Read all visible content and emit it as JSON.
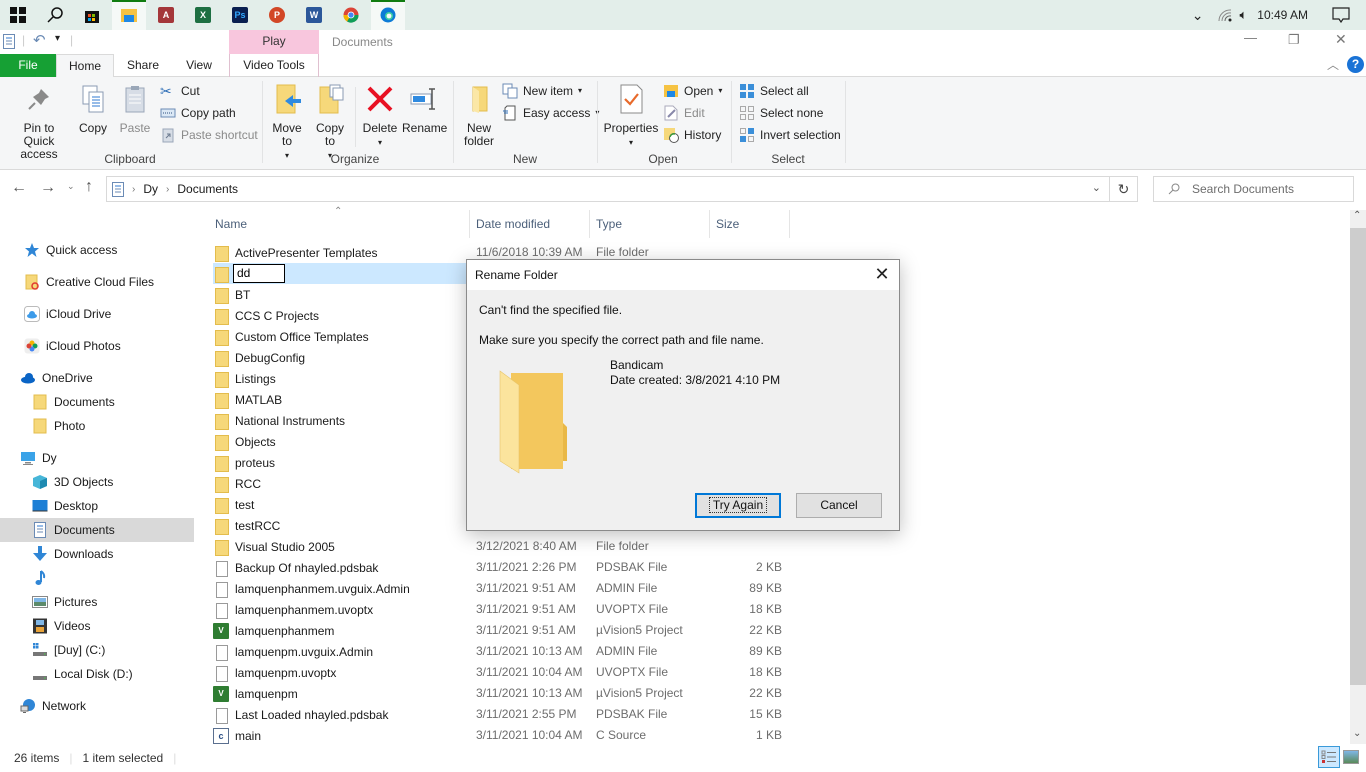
{
  "taskbar": {
    "apps": [
      {
        "name": "start",
        "label": "Start"
      },
      {
        "name": "search",
        "label": "Search"
      },
      {
        "name": "store",
        "label": "Microsoft Store"
      },
      {
        "name": "file-explorer",
        "label": "File Explorer",
        "active": true
      },
      {
        "name": "access",
        "label": "A"
      },
      {
        "name": "excel",
        "label": "X"
      },
      {
        "name": "photoshop",
        "label": "Ps"
      },
      {
        "name": "powerpoint",
        "label": "P"
      },
      {
        "name": "word",
        "label": "W"
      },
      {
        "name": "chrome",
        "label": "Chrome"
      },
      {
        "name": "edge",
        "label": "Edge",
        "active": true
      }
    ],
    "clock": "10:49 AM"
  },
  "window": {
    "title": "Documents",
    "contextual_tab_group": "Play",
    "minimize": "—",
    "restore": "❐",
    "close": "✕",
    "help": "?"
  },
  "tabs": {
    "file": "File",
    "home": "Home",
    "share": "Share",
    "view": "View",
    "video_tools": "Video Tools"
  },
  "ribbon": {
    "clipboard": {
      "label": "Clipboard",
      "pin": "Pin to Quick access",
      "copy": "Copy",
      "paste": "Paste",
      "cut": "Cut",
      "copy_path": "Copy path",
      "paste_shortcut": "Paste shortcut"
    },
    "organize": {
      "label": "Organize",
      "move_to": "Move to",
      "copy_to": "Copy to",
      "delete": "Delete",
      "rename": "Rename"
    },
    "new": {
      "label": "New",
      "new_folder": "New folder",
      "new_item": "New item",
      "easy_access": "Easy access"
    },
    "open": {
      "label": "Open",
      "properties": "Properties",
      "open": "Open",
      "edit": "Edit",
      "history": "History"
    },
    "select": {
      "label": "Select",
      "select_all": "Select all",
      "select_none": "Select none",
      "invert": "Invert selection"
    }
  },
  "address": {
    "breadcrumb": [
      "Dy",
      "Documents"
    ],
    "search_placeholder": "Search Documents"
  },
  "nav": {
    "items": [
      {
        "label": "Quick access",
        "icon": "star"
      },
      {
        "label": "Creative Cloud Files",
        "icon": "cc-folder"
      },
      {
        "label": "iCloud Drive",
        "icon": "icloud"
      },
      {
        "label": "iCloud Photos",
        "icon": "photos"
      },
      {
        "label": "OneDrive",
        "icon": "onedrive"
      },
      {
        "label": "Documents",
        "icon": "folder"
      },
      {
        "label": "Photo",
        "icon": "folder"
      },
      {
        "label": "Dy",
        "icon": "pc"
      },
      {
        "label": "3D Objects",
        "icon": "cube"
      },
      {
        "label": "Desktop",
        "icon": "desktop"
      },
      {
        "label": "Documents",
        "icon": "documents",
        "selected": true
      },
      {
        "label": "Downloads",
        "icon": "download"
      },
      {
        "label": "",
        "icon": "music"
      },
      {
        "label": "Pictures",
        "icon": "pictures"
      },
      {
        "label": "Videos",
        "icon": "videos"
      },
      {
        "label": "[Duy] (C:)",
        "icon": "drive-c"
      },
      {
        "label": "Local Disk (D:)",
        "icon": "drive"
      },
      {
        "label": "Network",
        "icon": "network"
      }
    ]
  },
  "columns": {
    "name": "Name",
    "date": "Date modified",
    "type": "Type",
    "size": "Size"
  },
  "files": [
    {
      "name": "ActivePresenter Templates",
      "date": "11/6/2018 10:39 AM",
      "type": "File folder",
      "size": "",
      "icon": "folder"
    },
    {
      "name": "dd",
      "date": "",
      "type": "",
      "size": "",
      "icon": "folder",
      "selected": true,
      "editing": true
    },
    {
      "name": "BT",
      "date": "",
      "type": "",
      "size": "",
      "icon": "folder"
    },
    {
      "name": "CCS C Projects",
      "date": "",
      "type": "",
      "size": "",
      "icon": "folder"
    },
    {
      "name": "Custom Office Templates",
      "date": "",
      "type": "",
      "size": "",
      "icon": "folder"
    },
    {
      "name": "DebugConfig",
      "date": "",
      "type": "",
      "size": "",
      "icon": "folder"
    },
    {
      "name": "Listings",
      "date": "",
      "type": "",
      "size": "",
      "icon": "folder"
    },
    {
      "name": "MATLAB",
      "date": "",
      "type": "",
      "size": "",
      "icon": "folder"
    },
    {
      "name": "National Instruments",
      "date": "",
      "type": "",
      "size": "",
      "icon": "folder"
    },
    {
      "name": "Objects",
      "date": "",
      "type": "",
      "size": "",
      "icon": "folder"
    },
    {
      "name": "proteus",
      "date": "",
      "type": "",
      "size": "",
      "icon": "folder"
    },
    {
      "name": "RCC",
      "date": "",
      "type": "",
      "size": "",
      "icon": "folder"
    },
    {
      "name": "test",
      "date": "",
      "type": "",
      "size": "",
      "icon": "folder"
    },
    {
      "name": "testRCC",
      "date": "",
      "type": "",
      "size": "",
      "icon": "folder"
    },
    {
      "name": "Visual Studio 2005",
      "date": "3/12/2021 8:40 AM",
      "type": "File folder",
      "size": "",
      "icon": "folder"
    },
    {
      "name": "Backup Of nhayled.pdsbak",
      "date": "3/11/2021 2:26 PM",
      "type": "PDSBAK File",
      "size": "2 KB",
      "icon": "file"
    },
    {
      "name": "lamquenphanmem.uvguix.Admin",
      "date": "3/11/2021 9:51 AM",
      "type": "ADMIN File",
      "size": "89 KB",
      "icon": "file"
    },
    {
      "name": "lamquenphanmem.uvoptx",
      "date": "3/11/2021 9:51 AM",
      "type": "UVOPTX File",
      "size": "18 KB",
      "icon": "file"
    },
    {
      "name": "lamquenphanmem",
      "date": "3/11/2021 9:51 AM",
      "type": "µVision5 Project",
      "size": "22 KB",
      "icon": "uvision"
    },
    {
      "name": "lamquenpm.uvguix.Admin",
      "date": "3/11/2021 10:13 AM",
      "type": "ADMIN File",
      "size": "89 KB",
      "icon": "file"
    },
    {
      "name": "lamquenpm.uvoptx",
      "date": "3/11/2021 10:04 AM",
      "type": "UVOPTX File",
      "size": "18 KB",
      "icon": "file"
    },
    {
      "name": "lamquenpm",
      "date": "3/11/2021 10:13 AM",
      "type": "µVision5 Project",
      "size": "22 KB",
      "icon": "uvision"
    },
    {
      "name": "Last Loaded nhayled.pdsbak",
      "date": "3/11/2021 2:55 PM",
      "type": "PDSBAK File",
      "size": "15 KB",
      "icon": "file"
    },
    {
      "name": "main",
      "date": "3/11/2021 10:04 AM",
      "type": "C Source",
      "size": "1 KB",
      "icon": "c-source"
    }
  ],
  "status": {
    "count": "26 items",
    "selected": "1 item selected"
  },
  "dialog": {
    "title": "Rename Folder",
    "message": "Can't find the specified file.",
    "detail": "Make sure you specify the correct path and file name.",
    "item_name": "Bandicam",
    "item_date": "Date created: 3/8/2021 4:10 PM",
    "try_again": "Try Again",
    "cancel": "Cancel",
    "close": "✕"
  },
  "colors": {
    "file_tab": "#16a034",
    "selection": "#cce8ff",
    "play_tab": "#f8c6dd",
    "accent": "#0078d7"
  }
}
